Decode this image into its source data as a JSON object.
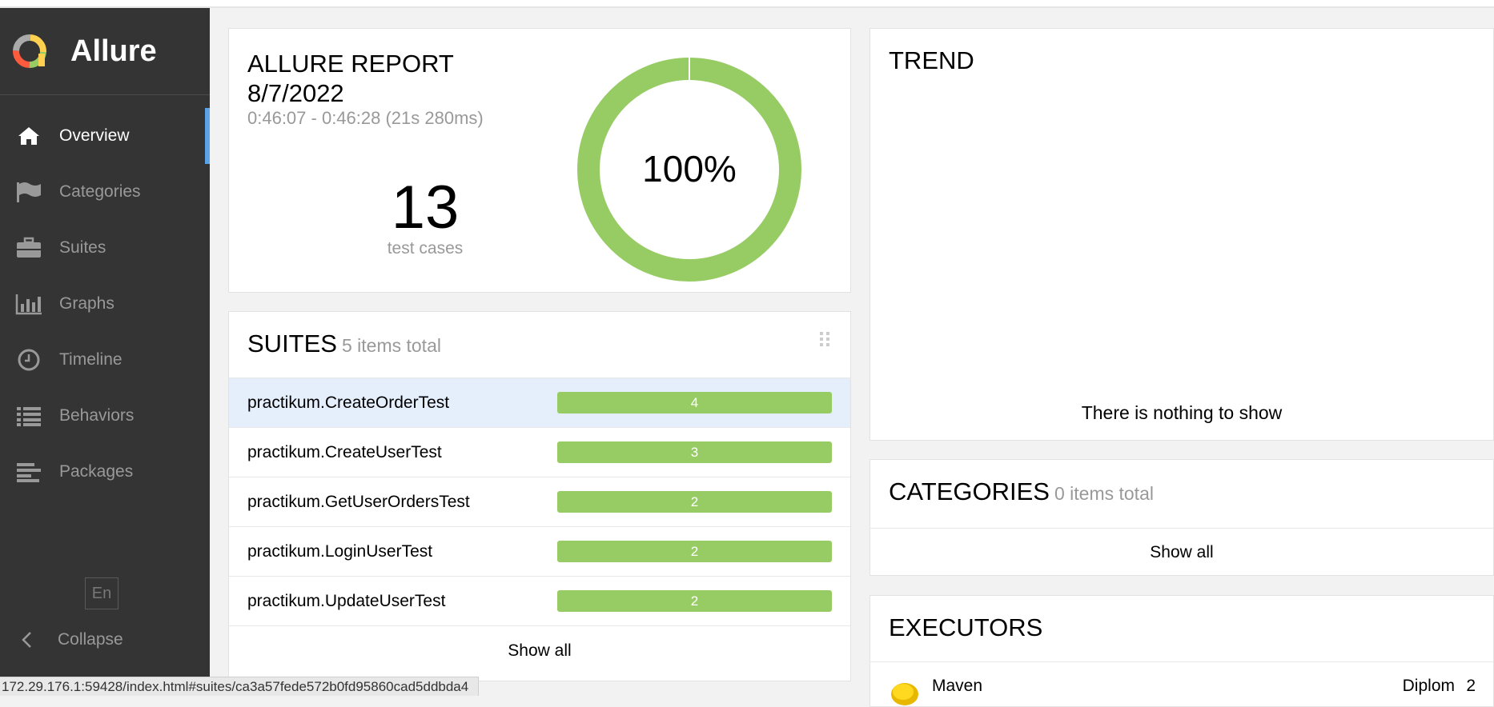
{
  "app": {
    "name": "Allure"
  },
  "sidebar": {
    "items": [
      {
        "label": "Overview",
        "icon": "home-icon",
        "active": true
      },
      {
        "label": "Categories",
        "icon": "flag-icon"
      },
      {
        "label": "Suites",
        "icon": "briefcase-icon"
      },
      {
        "label": "Graphs",
        "icon": "bar-chart-icon"
      },
      {
        "label": "Timeline",
        "icon": "clock-icon"
      },
      {
        "label": "Behaviors",
        "icon": "list-icon"
      },
      {
        "label": "Packages",
        "icon": "align-left-icon"
      }
    ],
    "language": "En",
    "collapse_label": "Collapse"
  },
  "summary": {
    "title": "ALLURE REPORT",
    "date": "8/7/2022",
    "time_range": "0:46:07 - 0:46:28 (21s 280ms)",
    "test_count": "13",
    "test_count_label": "test cases",
    "pass_rate": "100%",
    "pass_fraction": 1.0,
    "pass_color": "#97cc64"
  },
  "suites": {
    "title": "SUITES",
    "subtitle": "5 items total",
    "rows": [
      {
        "name": "practikum.CreateOrderTest",
        "count": "4"
      },
      {
        "name": "practikum.CreateUserTest",
        "count": "3"
      },
      {
        "name": "practikum.GetUserOrdersTest",
        "count": "2"
      },
      {
        "name": "practikum.LoginUserTest",
        "count": "2"
      },
      {
        "name": "practikum.UpdateUserTest",
        "count": "2"
      }
    ],
    "show_all": "Show all"
  },
  "trend": {
    "title": "TREND",
    "empty_message": "There is nothing to show"
  },
  "categories": {
    "title": "CATEGORIES",
    "subtitle": "0 items total",
    "show_all": "Show all"
  },
  "executors": {
    "title": "EXECUTORS",
    "rows": [
      {
        "name": "Maven",
        "build": "Diplom",
        "build_number": "2"
      }
    ]
  },
  "status_url": "172.29.176.1:59428/index.html#suites/ca3a57fede572b0fd95860cad5ddbda4"
}
